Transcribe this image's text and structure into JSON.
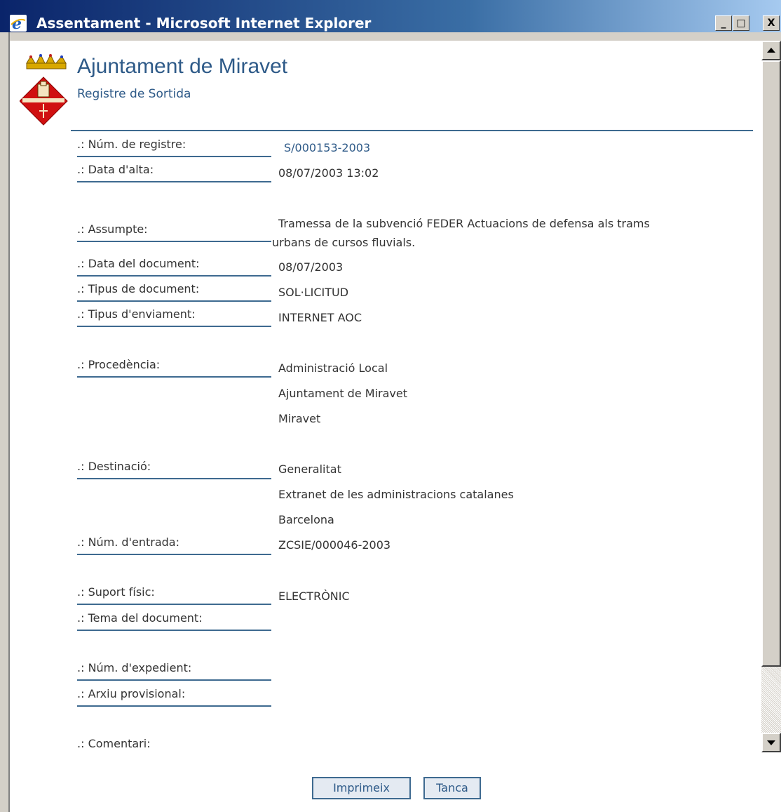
{
  "window": {
    "title": "Assentament - Microsoft Internet Explorer",
    "controls": {
      "minimize": "_",
      "maximize": "□",
      "close": "X"
    }
  },
  "header": {
    "organization": "Ajuntament de Miravet",
    "section": "Registre de Sortida"
  },
  "fields": {
    "num_registre": {
      "label": ".: Núm. de registre:",
      "value": "S/000153-2003"
    },
    "data_alta": {
      "label": ".: Data d'alta:",
      "value": "08/07/2003 13:02"
    },
    "assumpte": {
      "label": ".: Assumpte:",
      "value_line1": "Tramessa de la subvenció FEDER Actuacions de defensa als trams",
      "value_line2": "urbans de cursos fluvials."
    },
    "data_document": {
      "label": ".: Data del document:",
      "value": "08/07/2003"
    },
    "tipus_document": {
      "label": ".: Tipus de document:",
      "value": "SOL·LICITUD"
    },
    "tipus_enviament": {
      "label": ".: Tipus d'enviament:",
      "value": "INTERNET AOC"
    },
    "procedencia": {
      "label": ".: Procedència:",
      "values": [
        "Administració Local",
        "Ajuntament de Miravet",
        "Miravet"
      ]
    },
    "destinacio": {
      "label": ".: Destinació:",
      "values": [
        "Generalitat",
        "Extranet de les administracions catalanes",
        "Barcelona"
      ]
    },
    "num_entrada": {
      "label": ".: Núm. d'entrada:",
      "value": "ZCSIE/000046-2003"
    },
    "suport_fisic": {
      "label": ".: Suport físic:",
      "value": "ELECTRÒNIC"
    },
    "tema_document": {
      "label": ".: Tema del document:",
      "value": ""
    },
    "num_expedient": {
      "label": ".: Núm. d'expedient:",
      "value": ""
    },
    "arxiu_provisional": {
      "label": ".: Arxiu provisional:",
      "value": ""
    },
    "comentari": {
      "label": ".: Comentari:",
      "value": ""
    }
  },
  "buttons": {
    "print": "Imprimeix",
    "close": "Tanca"
  },
  "colors": {
    "titlebar": "#0a246a",
    "accent": "#2e5a88",
    "rule": "#3e6a90",
    "text": "#333333",
    "chrome": "#d4d0c8"
  }
}
